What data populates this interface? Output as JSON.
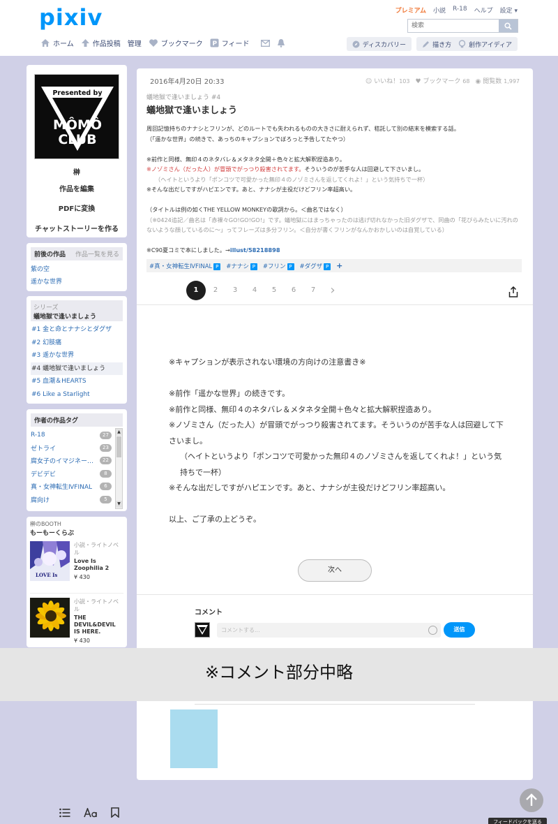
{
  "header": {
    "logo": "pixiv",
    "toplinks": [
      "プレミアム",
      "小説",
      "R-18",
      "ヘルプ",
      "設定 ▾"
    ],
    "search_placeholder": "検索",
    "nav": [
      "ホーム",
      "作品投稿",
      "管理",
      "ブックマーク",
      "フィード"
    ],
    "discovery": "ディスカバリー",
    "draw": "描き方",
    "idea": "創作アイディア"
  },
  "profile": {
    "image_text_1": "Presented by",
    "image_text_2": "MÔMÔ",
    "image_text_3": "CLUB",
    "name": "榊",
    "edit": "作品を編集",
    "pdf": "PDFに変換",
    "chat": "チャットストーリーを作る"
  },
  "related": {
    "title": "前後の作品",
    "more": "作品一覧を見る",
    "items": [
      "紫の空",
      "遥かな世界"
    ]
  },
  "series": {
    "label": "シリーズ",
    "name": "蟻地獄で逢いましょう",
    "items": [
      "#1 金と命とナナシとダグザ",
      "#2 幻肢痛",
      "#3 遥かな世界",
      "#4 蟻地獄で逢いましょう",
      "#5 血潮＆HEARTS",
      "#6 Like a Starlight"
    ]
  },
  "author_tags": {
    "title": "作者の作品タグ",
    "items": [
      {
        "name": "R-18",
        "count": "27"
      },
      {
        "name": "ゼトライ",
        "count": "23"
      },
      {
        "name": "腐女子のイマジネー…",
        "count": "22"
      },
      {
        "name": "デビデビ",
        "count": "8"
      },
      {
        "name": "真・女神転生ⅣFINAL",
        "count": "6"
      },
      {
        "name": "腐向け",
        "count": "5"
      }
    ]
  },
  "booth": {
    "owner": "榊のBOOTH",
    "shop": "もーもーくらぶ",
    "items": [
      {
        "category": "小説・ライトノベル",
        "title": "Love Is Zoophilia 2",
        "price": "¥ 430",
        "cover_text": "LOVE Is"
      },
      {
        "category": "小説・ライトノベル",
        "title": "THE DEVIL&DEVIL IS HERE.",
        "price": "¥ 430"
      }
    ]
  },
  "work": {
    "date": "2016年4月20日 20:33",
    "likes_label": "いいね！",
    "likes": "103",
    "bookmarks_label": "ブックマーク",
    "bookmarks": "68",
    "views_label": "閲覧数",
    "views": "1,997",
    "series_label": "蟻地獄で逢いましょう #4",
    "title": "蟻地獄で逢いましょう",
    "caption": {
      "l1": "周回記憶持ちのナナシとフリンが、どのルートでも失われるものの大きさに耐えられず、秸託して別の結末を模索する話。",
      "l2": "（「遥かな世界」の続きで、あっちのキャプションでぼろっと予告してたやつ）",
      "l3": "※前作と同様、無印４のネタバレ＆メタネタ全開＋色々と拡大解釈捏造あり。",
      "l4_red": "※ノゾミさん（だった人）が冒頭でがっつり殺害されてます。",
      "l4": "そういうのが苦手な人は回避して下さいまし。",
      "l5": "（ヘイトというより「ポンコツで可愛かった無印４のノゾミさんを返してくれよ！」という気持ちで一杯）",
      "l6": "※そんな出だしですがハピエンです。あと、ナナシが主役だけどフリン率超高い。",
      "l7": "（タイトルは例の如くTHE YELLOW MONKEYの歌詞から。＜曲名ではなく）",
      "l8": "（※0424追記／曲名は「赤裸々GO!GO!GO!」です。蟻地獄にはまっちゃったのは逃げ切れなかった旧ダグザで、同曲の「花びらみたいに汚れのないような顔しているのに〜」ってフレーズは多分フリン。＜自分が書くフリンがなんかおかしいのは自覚している）",
      "l9": "※C90夏コミで本にしました。→",
      "l9_link": "illust/58218898"
    },
    "tags": [
      "#真・女神転生ⅣFINAL",
      "#ナナシ",
      "#フリン",
      "#ダグザ"
    ],
    "tag_badge": "P",
    "tag_add": "+",
    "pages": [
      "1",
      "2",
      "3",
      "4",
      "5",
      "6",
      "7"
    ],
    "pager_next": "›",
    "body": {
      "p1": "※キャプションが表示されない環境の方向けの注意書き※",
      "p2": "※前作「遥かな世界」の続きです。",
      "p3": "※前作と同様、無印４のネタバレ＆メタネタ全開＋色々と拡大解釈捏造あり。",
      "p4": "※ノゾミさん（だった人）が冒頭でがっつり殺害されてます。そういうのが苦手な人は回避して下さいまし。",
      "p5": "（ヘイトというより「ポンコツで可愛かった無印４のノゾミさんを返してくれよ！」という気持ちで一杯）",
      "p6": "※そんな出だしですがハピエンです。あと、ナナシが主役だけどフリン率超高い。",
      "p7": "以上、ご了承の上どうぞ。"
    },
    "next_label": "次へ"
  },
  "comments": {
    "title": "コメント",
    "placeholder": "コメントする...",
    "send": "送信"
  },
  "overlay_note": "※コメント部分中略",
  "feedback": "フィードバックを送る",
  "icons": [
    "home-icon",
    "upload-icon",
    "heart-icon",
    "feed-icon",
    "mail-icon",
    "bell-icon",
    "search-icon",
    "compass-icon",
    "pen-icon",
    "bulb-icon",
    "share-icon",
    "list-icon",
    "font-icon",
    "bookmark-icon"
  ],
  "colors": {
    "brand": "#0096fa",
    "background": "#d0d0e7",
    "premium": "#f07a3a",
    "caution_red": "#d13b3b",
    "link": "#2b6bb3"
  }
}
